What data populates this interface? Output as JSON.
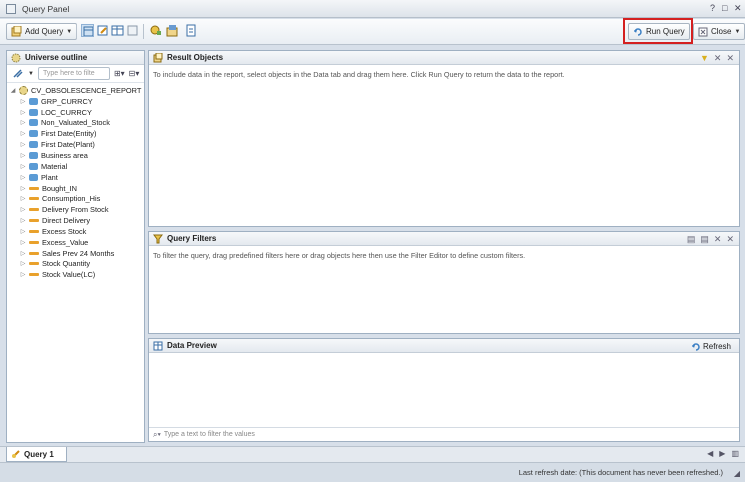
{
  "window": {
    "title": "Query Panel",
    "controls": [
      "?",
      "□",
      "✕"
    ]
  },
  "toolbar": {
    "add_query_label": "Add Query",
    "run_query_label": "Run Query",
    "close_label": "Close"
  },
  "outline": {
    "title": "Universe outline",
    "search_placeholder": "Type here to filte",
    "root_label": "CV_OBSOLESCENCE_REPORT",
    "items": [
      {
        "label": "GRP_CURRCY",
        "kind": "dimension"
      },
      {
        "label": "LOC_CURRCY",
        "kind": "dimension"
      },
      {
        "label": "Non_Valuated_Stock",
        "kind": "dimension"
      },
      {
        "label": "First Date(Entity)",
        "kind": "dimension"
      },
      {
        "label": "First Date(Plant)",
        "kind": "dimension"
      },
      {
        "label": "Business area",
        "kind": "dimension"
      },
      {
        "label": "Material",
        "kind": "dimension"
      },
      {
        "label": "Plant",
        "kind": "dimension"
      },
      {
        "label": "Bought_IN",
        "kind": "measure"
      },
      {
        "label": "Consumption_His",
        "kind": "measure"
      },
      {
        "label": "Delivery From Stock",
        "kind": "measure"
      },
      {
        "label": "Direct Delivery",
        "kind": "measure"
      },
      {
        "label": "Excess Stock",
        "kind": "measure"
      },
      {
        "label": "Excess_Value",
        "kind": "measure"
      },
      {
        "label": "Sales Prev 24 Months",
        "kind": "measure"
      },
      {
        "label": "Stock Quantity",
        "kind": "measure"
      },
      {
        "label": "Stock Value(LC)",
        "kind": "measure"
      }
    ]
  },
  "result_objects": {
    "title": "Result Objects",
    "hint": "To include data in the report, select objects in the Data tab and drag them here. Click Run Query to return the data to the report."
  },
  "query_filters": {
    "title": "Query Filters",
    "hint": "To filter the query, drag predefined filters here or drag objects here then use the Filter Editor to define custom filters."
  },
  "data_preview": {
    "title": "Data Preview",
    "refresh_label": "Refresh",
    "filter_placeholder": "Type a text to filter the values"
  },
  "tabs": [
    {
      "label": "Query 1"
    }
  ],
  "status": {
    "text": "Last refresh date: (This document has never been refreshed.)"
  },
  "colors": {
    "highlight_box": "#d42020",
    "dimension_icon": "#5b9bd5",
    "measure_icon": "#e9a12c"
  }
}
